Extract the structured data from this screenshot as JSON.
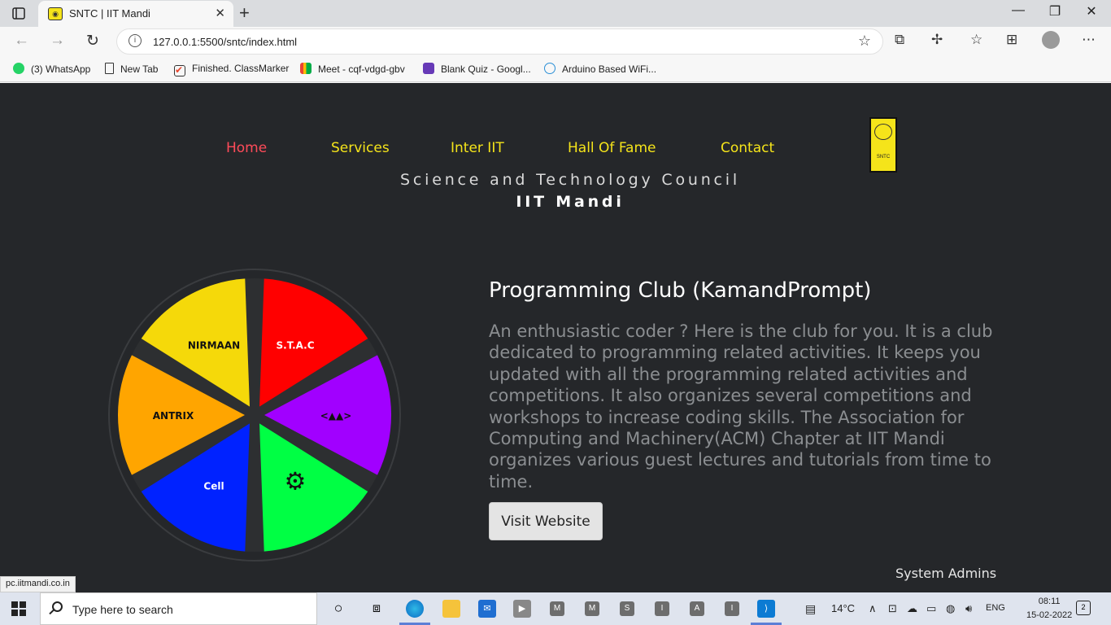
{
  "browser": {
    "tab_title": "SNTC | IIT Mandi",
    "tab_close": "✕",
    "new_tab": "+",
    "url": "127.0.0.1:5500/sntc/index.html",
    "status_url": "pc.iitmandi.co.in",
    "window_controls": {
      "minimize": "—",
      "restore": "❐",
      "close": "✕"
    },
    "bookmarks": [
      {
        "label": "(3) WhatsApp",
        "icon": "whatsapp-icon",
        "color": "#25d366"
      },
      {
        "label": "New Tab",
        "icon": "page-icon",
        "color": "#ffffff"
      },
      {
        "label": "Finished. ClassMarker",
        "icon": "checkmark-icon",
        "color": "#e8452c"
      },
      {
        "label": "Meet - cqf-vdgd-gbv",
        "icon": "meet-icon",
        "color": "#00ac47"
      },
      {
        "label": "Blank Quiz - Googl...",
        "icon": "forms-icon",
        "color": "#673ab7"
      },
      {
        "label": "Arduino Based WiFi...",
        "icon": "globe-icon",
        "color": "#2b8fd6"
      }
    ]
  },
  "site": {
    "nav": [
      {
        "label": "Home",
        "active": true
      },
      {
        "label": "Services",
        "active": false
      },
      {
        "label": "Inter IIT",
        "active": false
      },
      {
        "label": "Hall Of Fame",
        "active": false
      },
      {
        "label": "Contact",
        "active": false
      }
    ],
    "logo_text": "SNTC",
    "council": "Science and Technology Council",
    "college": "IIT Mandi",
    "wheel": {
      "segments": [
        {
          "color": "#ff0000",
          "label": "S.T.A.C"
        },
        {
          "color": "#a100ff",
          "label": "<▲▲>"
        },
        {
          "color": "#00ff44",
          "label": "robot-icon"
        },
        {
          "color": "#0022ff",
          "label": "Cell"
        },
        {
          "color": "#ffa500",
          "label": "ANTRIX"
        },
        {
          "color": "#f5d90a",
          "label": "NIRMAAN"
        }
      ]
    },
    "club": {
      "title": "Programming Club (KamandPrompt)",
      "description": "An enthusiastic coder ? Here is the club for you. It is a club dedicated to programming related activities. It keeps you updated with all the programming related activities and competitions. It also organizes several competitions and workshops to increase coding skills. The Association for Computing and Machinery(ACM) Chapter at IIT Mandi organizes various guest lectures and tutorials from time to time.",
      "button": "Visit Website"
    },
    "footer_label": "System Admins"
  },
  "taskbar": {
    "search_placeholder": "Type here to search",
    "apps": [
      "M",
      "M",
      "S",
      "I",
      "A",
      "I"
    ],
    "weather": "14°C",
    "lang": "ENG",
    "time": "08:11",
    "date": "15-02-2022",
    "notifications": "2"
  },
  "colors": {
    "accent_yellow": "#f5e41a",
    "active_red": "#ff4b59",
    "page_bg": "#25272a"
  }
}
